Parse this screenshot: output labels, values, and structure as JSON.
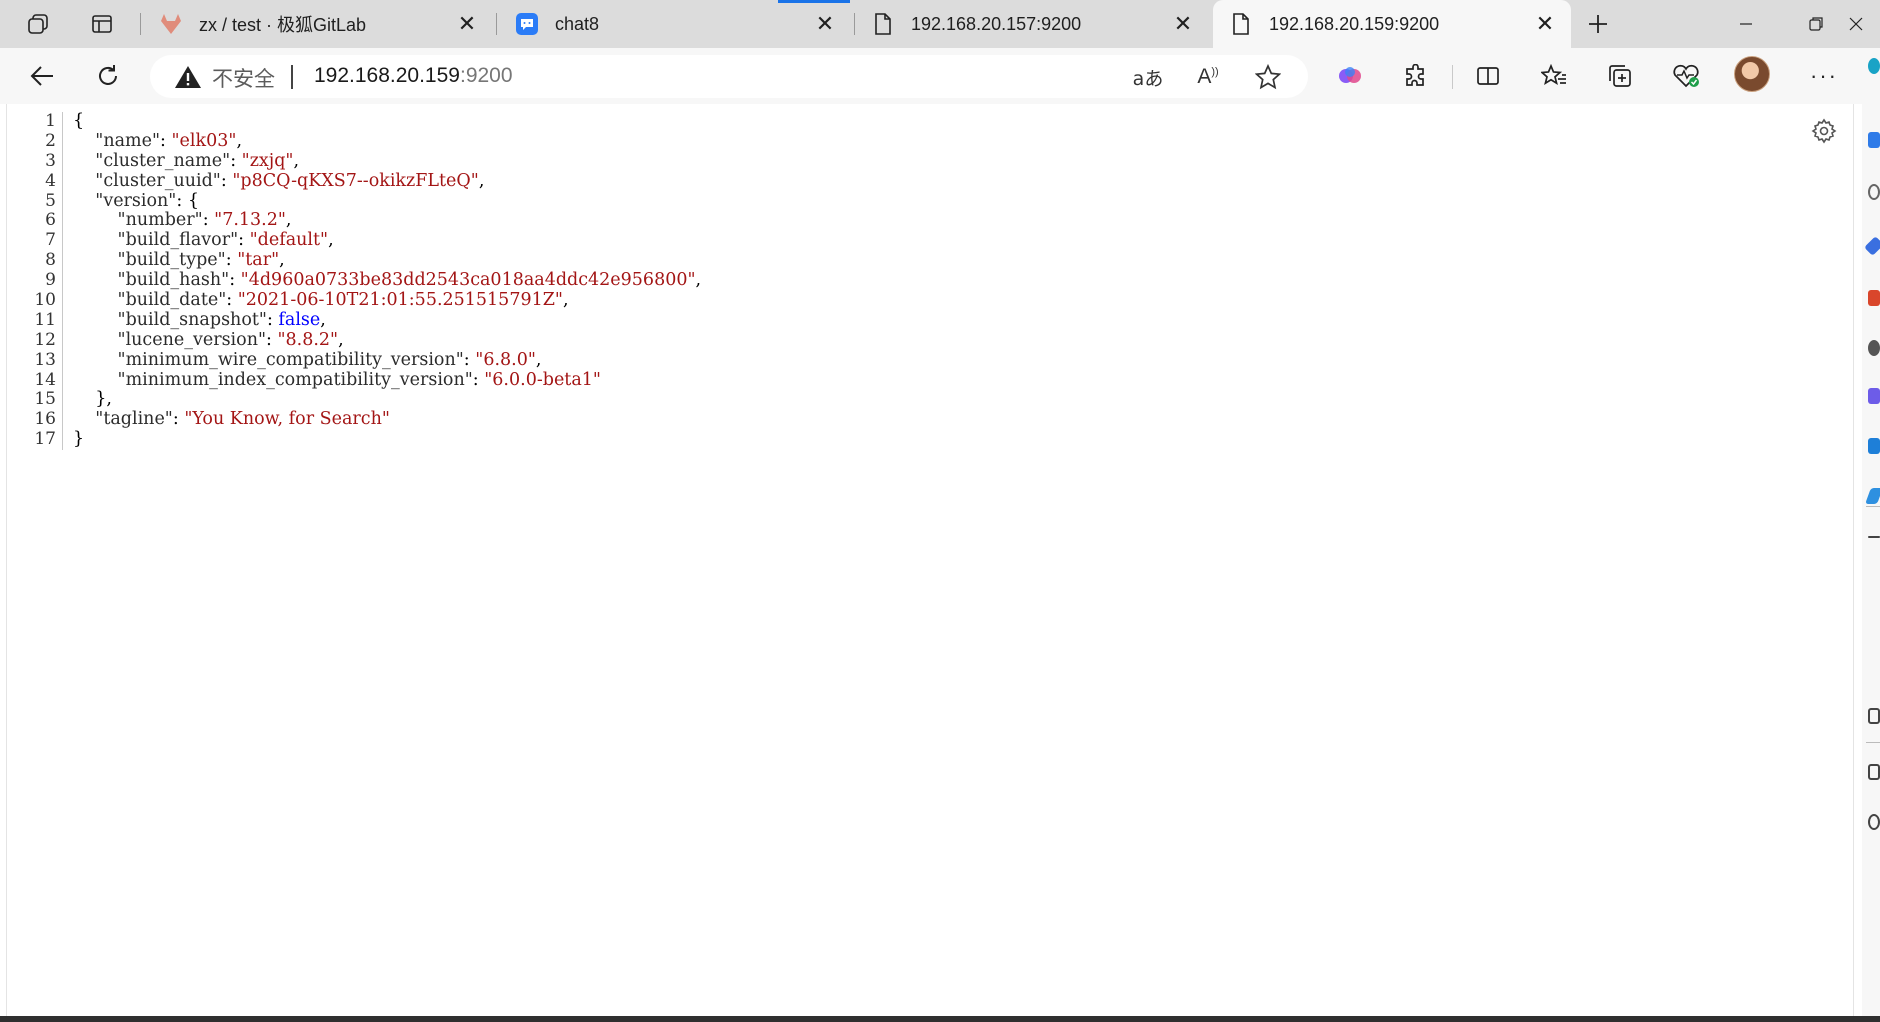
{
  "tabs": [
    {
      "title": "zx / test · 极狐GitLab",
      "icon": "gitlab-fox-icon",
      "active": false
    },
    {
      "title": "chat8",
      "icon": "chat-bubble-icon",
      "active": false
    },
    {
      "title": "192.168.20.157:9200",
      "icon": "page-icon",
      "active": false
    },
    {
      "title": "192.168.20.159:9200",
      "icon": "page-icon",
      "active": true
    }
  ],
  "address": {
    "security_label": "不安全",
    "host": "192.168.20.159",
    "port": ":9200"
  },
  "toolbar_icons": [
    "back-icon",
    "refresh-icon",
    "translate-icon",
    "read-aloud-icon",
    "favorite-star-icon",
    "copilot-icon",
    "extensions-icon",
    "split-screen-icon",
    "favorites-icon",
    "collections-icon",
    "browser-essentials-icon",
    "profile-avatar",
    "more-icon"
  ],
  "json_lines": [
    {
      "num": "1",
      "parts": [
        {
          "t": "{",
          "c": "p"
        }
      ]
    },
    {
      "num": "2",
      "parts": [
        {
          "t": "    ",
          "c": "p"
        },
        {
          "t": "\"name\"",
          "c": "q"
        },
        {
          "t": ": ",
          "c": "p"
        },
        {
          "t": "\"elk03\"",
          "c": "s"
        },
        {
          "t": ",",
          "c": "p"
        }
      ]
    },
    {
      "num": "3",
      "parts": [
        {
          "t": "    ",
          "c": "p"
        },
        {
          "t": "\"cluster_name\"",
          "c": "q"
        },
        {
          "t": ": ",
          "c": "p"
        },
        {
          "t": "\"zxjq\"",
          "c": "s"
        },
        {
          "t": ",",
          "c": "p"
        }
      ]
    },
    {
      "num": "4",
      "parts": [
        {
          "t": "    ",
          "c": "p"
        },
        {
          "t": "\"cluster_uuid\"",
          "c": "q"
        },
        {
          "t": ": ",
          "c": "p"
        },
        {
          "t": "\"p8CQ-qKXS7--okikzFLteQ\"",
          "c": "s"
        },
        {
          "t": ",",
          "c": "p"
        }
      ]
    },
    {
      "num": "5",
      "parts": [
        {
          "t": "    ",
          "c": "p"
        },
        {
          "t": "\"version\"",
          "c": "q"
        },
        {
          "t": ": {",
          "c": "p"
        }
      ]
    },
    {
      "num": "6",
      "parts": [
        {
          "t": "        ",
          "c": "p"
        },
        {
          "t": "\"number\"",
          "c": "q"
        },
        {
          "t": ": ",
          "c": "p"
        },
        {
          "t": "\"7.13.2\"",
          "c": "s"
        },
        {
          "t": ",",
          "c": "p"
        }
      ]
    },
    {
      "num": "7",
      "parts": [
        {
          "t": "        ",
          "c": "p"
        },
        {
          "t": "\"build_flavor\"",
          "c": "q"
        },
        {
          "t": ": ",
          "c": "p"
        },
        {
          "t": "\"default\"",
          "c": "s"
        },
        {
          "t": ",",
          "c": "p"
        }
      ]
    },
    {
      "num": "8",
      "parts": [
        {
          "t": "        ",
          "c": "p"
        },
        {
          "t": "\"build_type\"",
          "c": "q"
        },
        {
          "t": ": ",
          "c": "p"
        },
        {
          "t": "\"tar\"",
          "c": "s"
        },
        {
          "t": ",",
          "c": "p"
        }
      ]
    },
    {
      "num": "9",
      "parts": [
        {
          "t": "        ",
          "c": "p"
        },
        {
          "t": "\"build_hash\"",
          "c": "q"
        },
        {
          "t": ": ",
          "c": "p"
        },
        {
          "t": "\"4d960a0733be83dd2543ca018aa4ddc42e956800\"",
          "c": "s"
        },
        {
          "t": ",",
          "c": "p"
        }
      ]
    },
    {
      "num": "10",
      "parts": [
        {
          "t": "        ",
          "c": "p"
        },
        {
          "t": "\"build_date\"",
          "c": "q"
        },
        {
          "t": ": ",
          "c": "p"
        },
        {
          "t": "\"2021-06-10T21:01:55.251515791Z\"",
          "c": "s"
        },
        {
          "t": ",",
          "c": "p"
        }
      ]
    },
    {
      "num": "11",
      "parts": [
        {
          "t": "        ",
          "c": "p"
        },
        {
          "t": "\"build_snapshot\"",
          "c": "q"
        },
        {
          "t": ": ",
          "c": "p"
        },
        {
          "t": "false",
          "c": "kw"
        },
        {
          "t": ",",
          "c": "p"
        }
      ]
    },
    {
      "num": "12",
      "parts": [
        {
          "t": "        ",
          "c": "p"
        },
        {
          "t": "\"lucene_version\"",
          "c": "q"
        },
        {
          "t": ": ",
          "c": "p"
        },
        {
          "t": "\"8.8.2\"",
          "c": "s"
        },
        {
          "t": ",",
          "c": "p"
        }
      ]
    },
    {
      "num": "13",
      "parts": [
        {
          "t": "        ",
          "c": "p"
        },
        {
          "t": "\"minimum_wire_compatibility_version\"",
          "c": "q"
        },
        {
          "t": ": ",
          "c": "p"
        },
        {
          "t": "\"6.8.0\"",
          "c": "s"
        },
        {
          "t": ",",
          "c": "p"
        }
      ]
    },
    {
      "num": "14",
      "parts": [
        {
          "t": "        ",
          "c": "p"
        },
        {
          "t": "\"minimum_index_compatibility_version\"",
          "c": "q"
        },
        {
          "t": ": ",
          "c": "p"
        },
        {
          "t": "\"6.0.0-beta1\"",
          "c": "s"
        }
      ]
    },
    {
      "num": "15",
      "parts": [
        {
          "t": "    },",
          "c": "p"
        }
      ]
    },
    {
      "num": "16",
      "parts": [
        {
          "t": "    ",
          "c": "p"
        },
        {
          "t": "\"tagline\"",
          "c": "q"
        },
        {
          "t": ": ",
          "c": "p"
        },
        {
          "t": "\"You Know, for Search\"",
          "c": "s"
        }
      ]
    },
    {
      "num": "17",
      "parts": [
        {
          "t": "}",
          "c": "p"
        }
      ]
    }
  ],
  "colors": {
    "string": "#a31515",
    "keyword": "#0000ff",
    "accent": "#1a73e8"
  }
}
